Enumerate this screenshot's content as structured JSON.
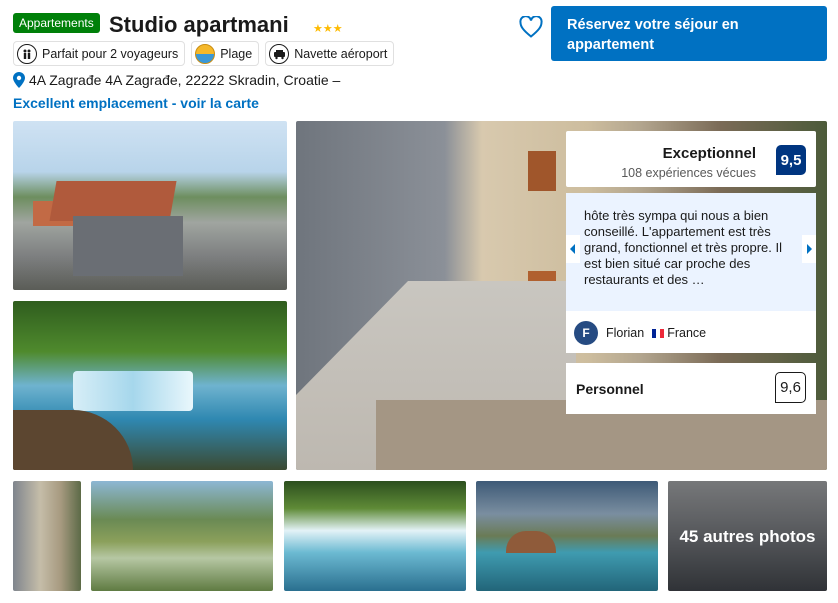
{
  "property": {
    "type_badge": "Appartements",
    "name": "Studio apartmani",
    "stars": "★★★",
    "address": "4A Zagrađe 4A Zagrađe, 22222 Skradin, Croatie –",
    "map_link": "Excellent emplacement - voir la carte"
  },
  "highlights": [
    {
      "label": "Parfait pour 2 voyageurs",
      "icon": "people-icon"
    },
    {
      "label": "Plage",
      "icon": "beach-icon"
    },
    {
      "label": "Navette aéroport",
      "icon": "shuttle-icon"
    }
  ],
  "actions": {
    "reserve_label": "Réservez votre séjour en appartement",
    "favorite_icon": "heart-icon"
  },
  "rating": {
    "label": "Exceptionnel",
    "count": "108 expériences vécues",
    "score": "9,5"
  },
  "review": {
    "text": "hôte très sympa qui nous a bien conseillé. L'appartement est très grand, fonctionnel et très propre. Il est bien situé car proche des restaurants et des …",
    "initial": "F",
    "author": "Florian",
    "country": "France",
    "prev_icon": "chevron-left-icon",
    "next_icon": "chevron-right-icon"
  },
  "staff": {
    "label": "Personnel",
    "score": "9,6"
  },
  "gallery": {
    "more_photos": "45 autres photos"
  },
  "colors": {
    "accent": "#0071c2",
    "score_bg": "#003580",
    "badge_green": "#008009",
    "star": "#febb02"
  }
}
